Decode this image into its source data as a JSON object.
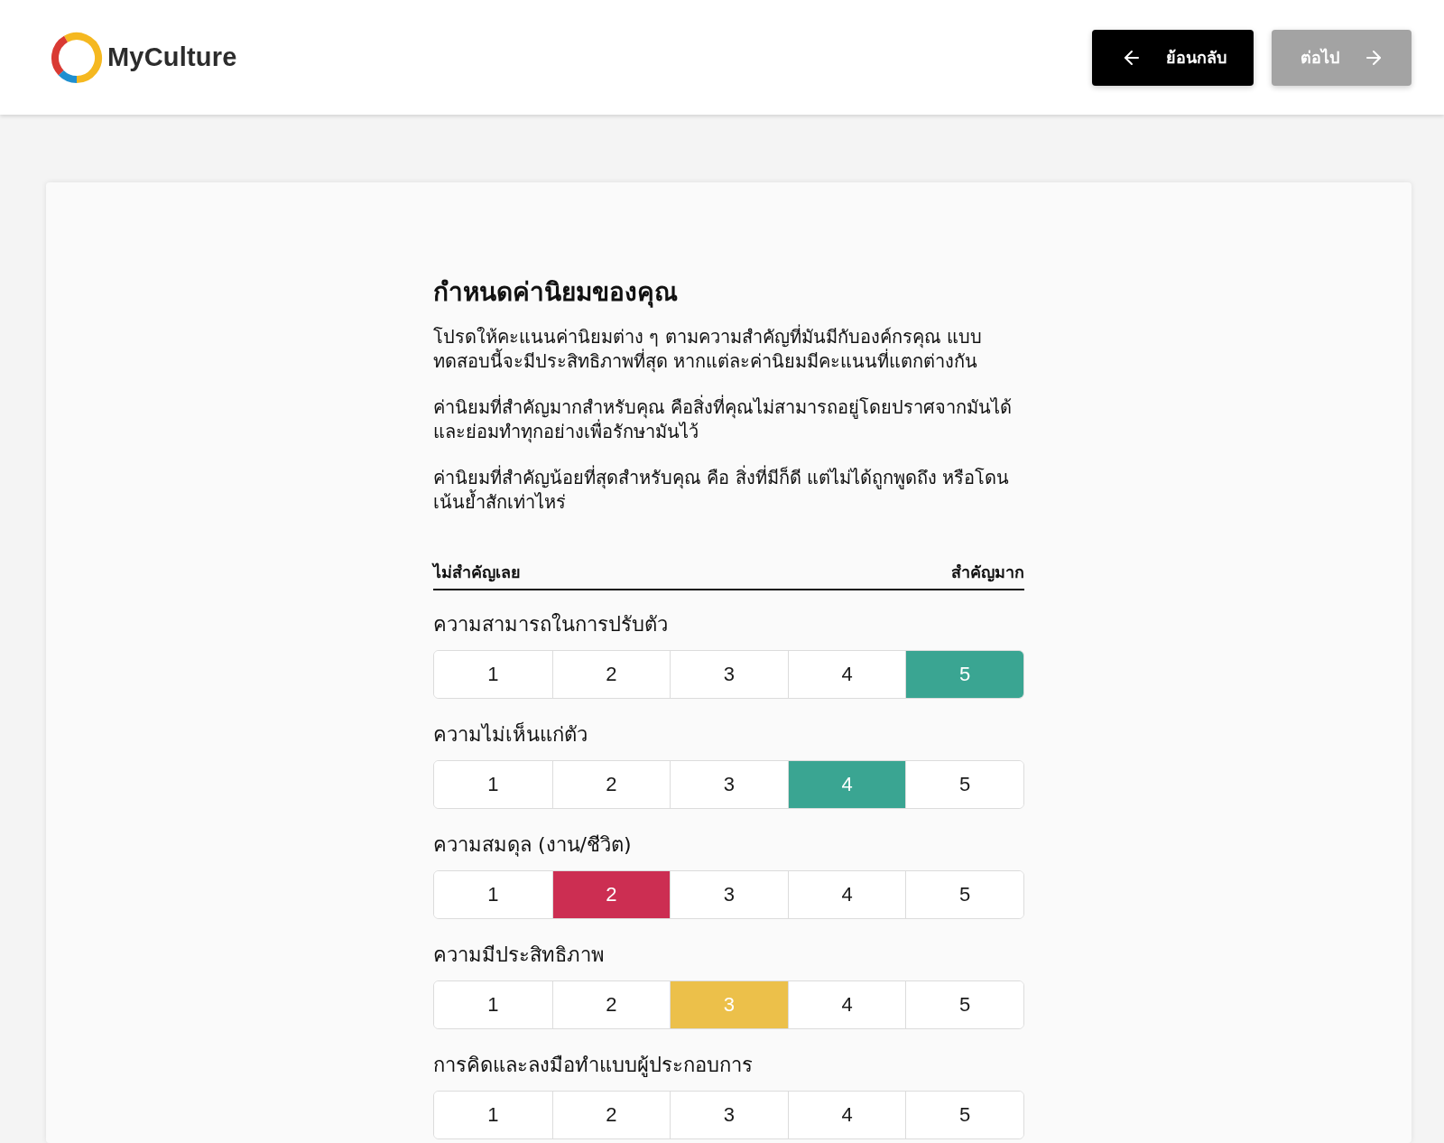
{
  "header": {
    "logo_text": "MyCulture",
    "buttons": [
      {
        "kind": "back",
        "label": "ย้อนกลับ",
        "disabled": false
      },
      {
        "kind": "next",
        "label": "ต่อไป",
        "disabled": true
      }
    ]
  },
  "card": {
    "title": "กำหนดค่านิยมของคุณ",
    "paragraphs": [
      "โปรดให้คะแนนค่านิยมต่าง ๆ ตามความสำคัญที่มันมีกับองค์กรคุณ แบบทดสอบนี้จะมีประสิทธิภาพที่สุด หากแต่ละค่านิยมมีคะแนนที่แตกต่างกัน",
      "ค่านิยมที่สำคัญมากสำหรับคุณ คือสิ่งที่คุณไม่สามารถอยู่โดยปราศจากมันได้ และย่อมทำทุกอย่างเพื่อรักษามันไว้",
      "ค่านิยมที่สำคัญน้อยที่สุดสำหรับคุณ คือ สิ่งที่มีก็ดี แต่ไม่ได้ถูกพูดถึง หรือโดนเน้นย้ำสักเท่าไหร่"
    ],
    "scale": {
      "low_label": "ไม่สำคัญเลย",
      "high_label": "สำคัญมาก"
    },
    "ratings": [
      {
        "label": "ความสามารถในการปรับตัว",
        "color": "#3aa592",
        "options": [
          {
            "label": "1",
            "selected": false
          },
          {
            "label": "2",
            "selected": false
          },
          {
            "label": "3",
            "selected": false
          },
          {
            "label": "4",
            "selected": false
          },
          {
            "label": "5",
            "selected": true
          }
        ]
      },
      {
        "label": "ความไม่เห็นแก่ตัว",
        "color": "#3aa592",
        "options": [
          {
            "label": "1",
            "selected": false
          },
          {
            "label": "2",
            "selected": false
          },
          {
            "label": "3",
            "selected": false
          },
          {
            "label": "4",
            "selected": true
          },
          {
            "label": "5",
            "selected": false
          }
        ]
      },
      {
        "label": "ความสมดุล (งาน/ชีวิต)",
        "color": "#cc2e52",
        "options": [
          {
            "label": "1",
            "selected": false
          },
          {
            "label": "2",
            "selected": true
          },
          {
            "label": "3",
            "selected": false
          },
          {
            "label": "4",
            "selected": false
          },
          {
            "label": "5",
            "selected": false
          }
        ]
      },
      {
        "label": "ความมีประสิทธิภาพ",
        "color": "#ecc04a",
        "options": [
          {
            "label": "1",
            "selected": false
          },
          {
            "label": "2",
            "selected": false
          },
          {
            "label": "3",
            "selected": true
          },
          {
            "label": "4",
            "selected": false
          },
          {
            "label": "5",
            "selected": false
          }
        ]
      },
      {
        "label": "การคิดและลงมือทำแบบผู้ประกอบการ",
        "options": [
          {
            "label": "1",
            "selected": false
          },
          {
            "label": "2",
            "selected": false
          },
          {
            "label": "3",
            "selected": false
          },
          {
            "label": "4",
            "selected": false
          },
          {
            "label": "5",
            "selected": false
          }
        ]
      }
    ]
  }
}
